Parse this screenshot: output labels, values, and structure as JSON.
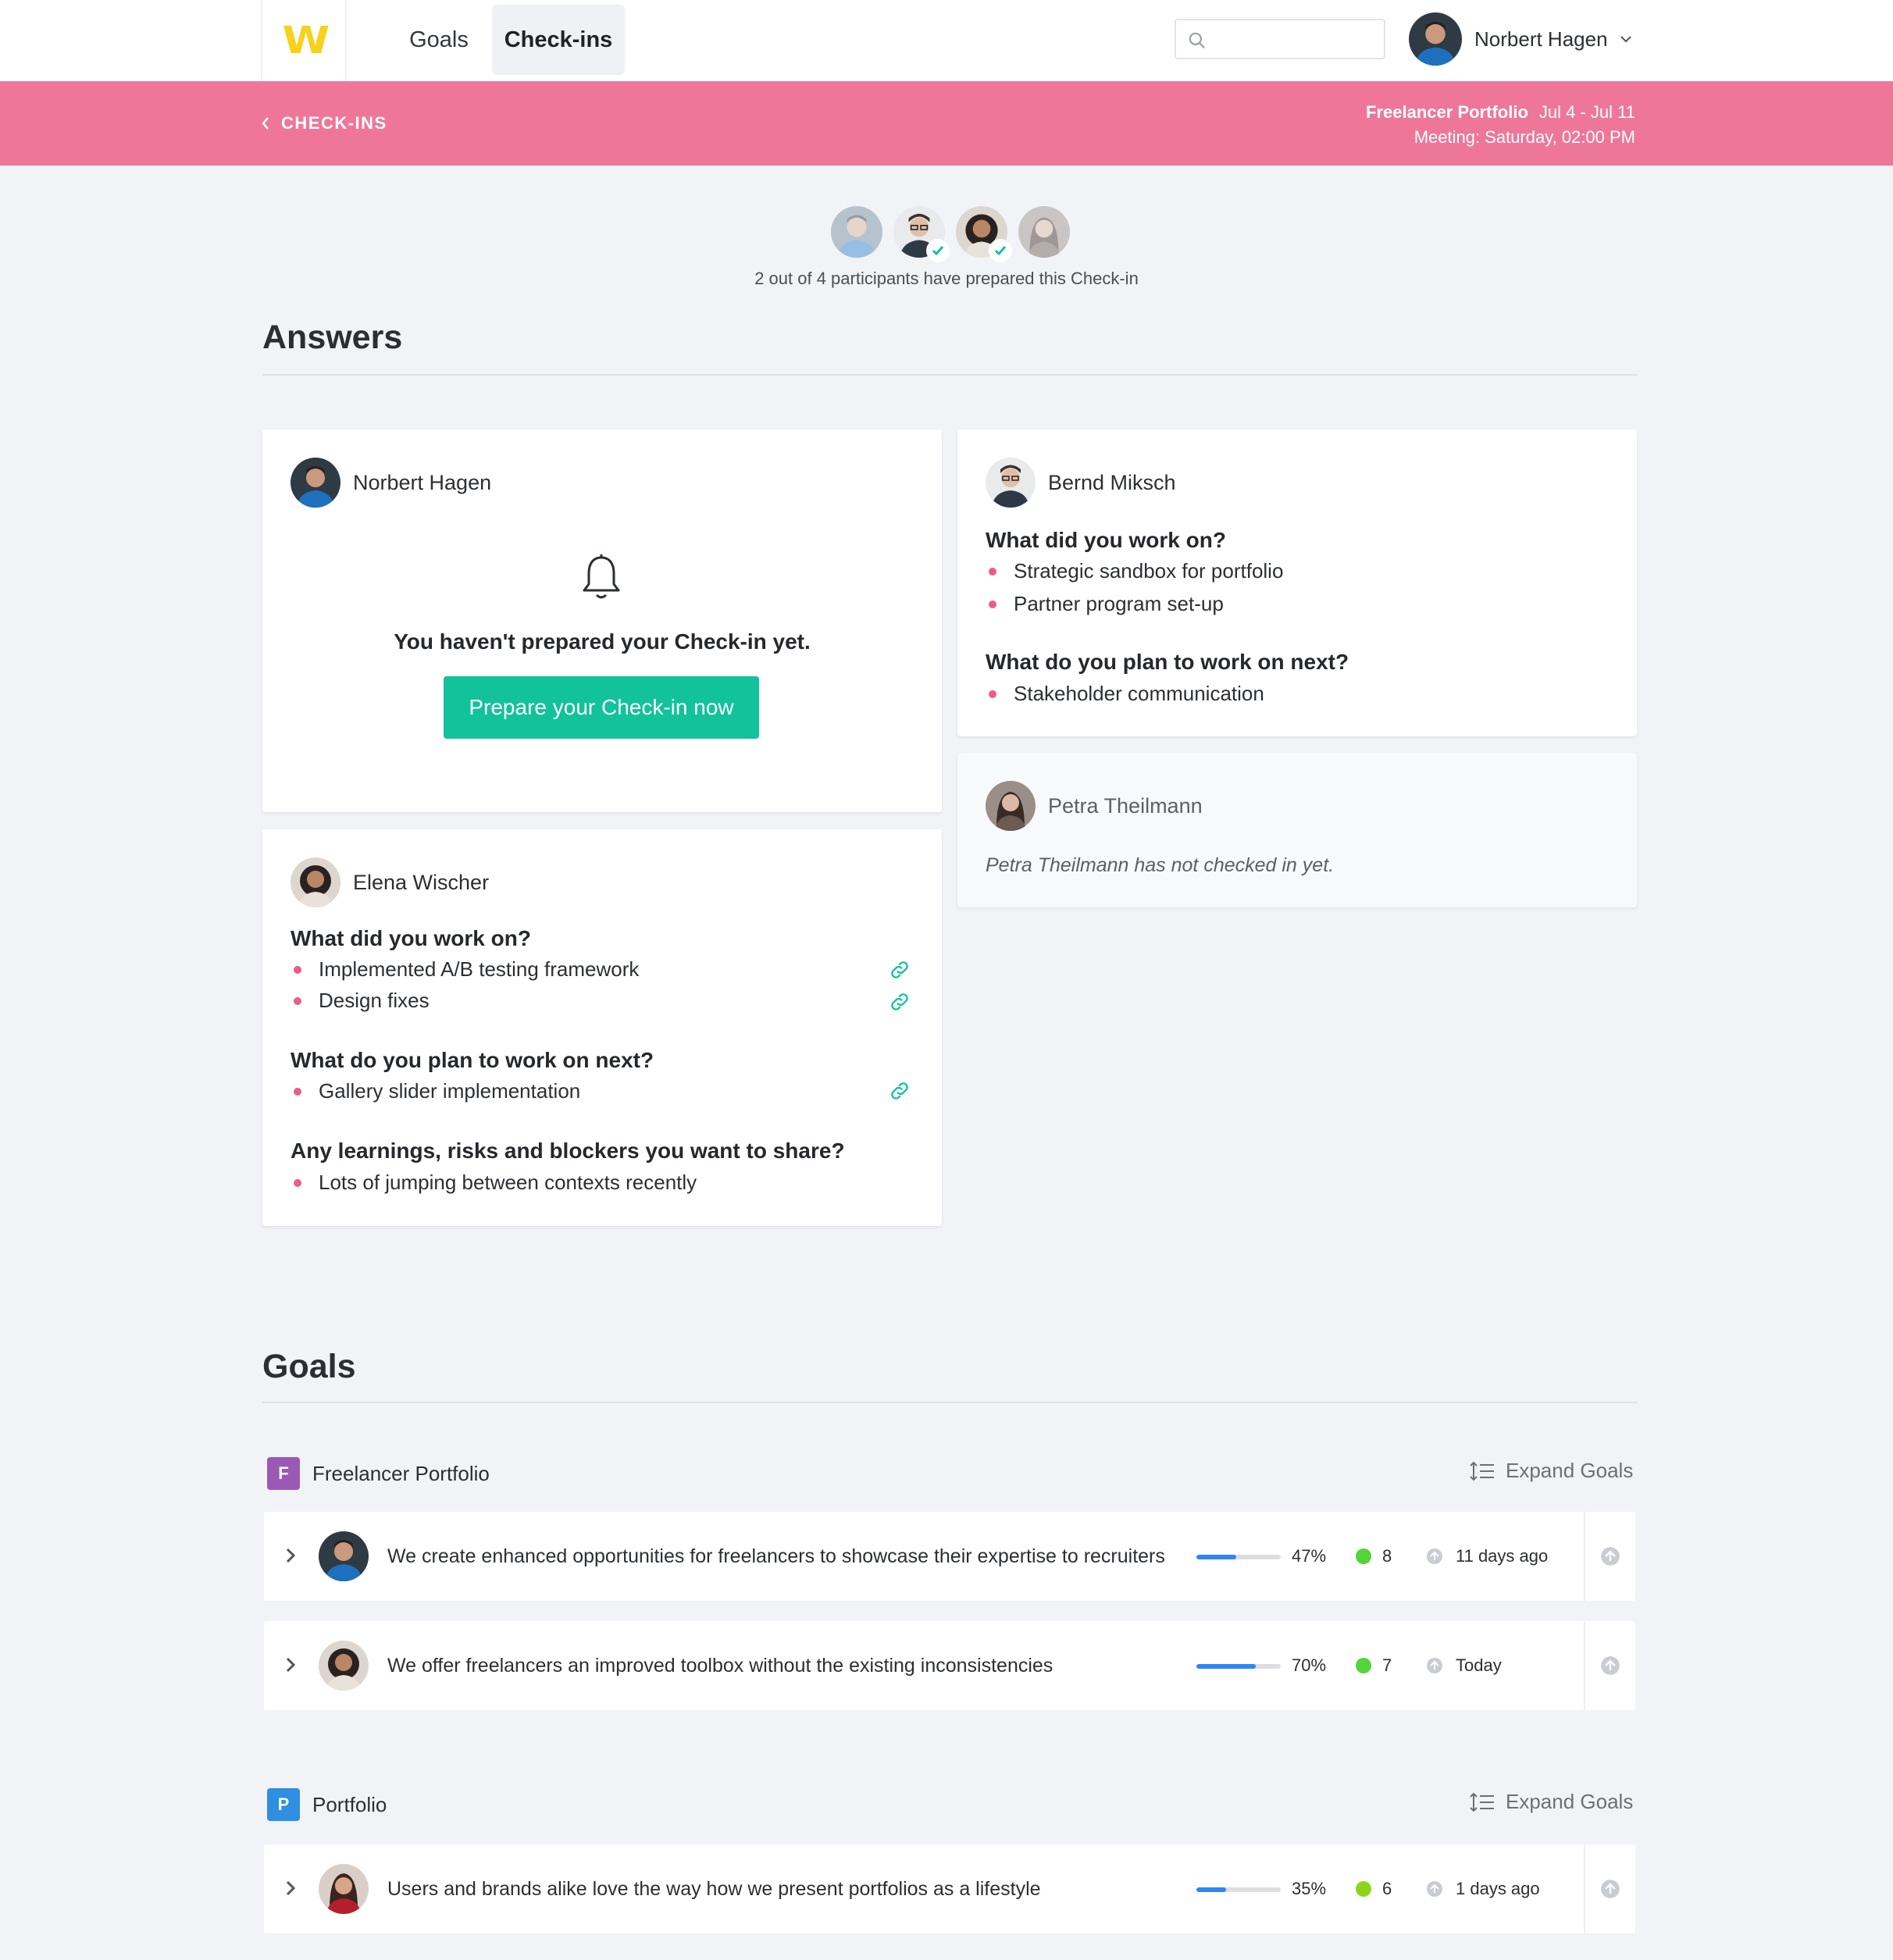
{
  "app": {
    "logo_text": "W",
    "brand_color": "#f7d21b",
    "accent_color": "#ee7799",
    "primary_color": "#12c29b"
  },
  "nav": {
    "tabs": [
      {
        "label": "Goals"
      },
      {
        "label": "Check-ins",
        "active": true
      }
    ]
  },
  "search": {
    "placeholder": "",
    "icon": "search-icon"
  },
  "user": {
    "name": "Norbert Hagen"
  },
  "banner": {
    "back_label": "CHECK-INS",
    "project": "Freelancer Portfolio",
    "date_range": "Jul 4 - Jul 11",
    "meeting": "Meeting: Saturday, 02:00 PM"
  },
  "participants": {
    "people": [
      {
        "name": "Norbert Hagen",
        "prepared": false
      },
      {
        "name": "Bernd Miksch",
        "prepared": true
      },
      {
        "name": "Elena Wischer",
        "prepared": true
      },
      {
        "name": "Petra Theilmann",
        "prepared": false
      }
    ],
    "summary": "2 out of 4 participants have prepared this Check-in"
  },
  "answers": {
    "title": "Answers",
    "norbert": {
      "name": "Norbert Hagen",
      "message": "You haven't prepared your Check-in yet.",
      "button": "Prepare your Check-in now"
    },
    "bernd": {
      "name": "Bernd Miksch",
      "q1": "What did you work on?",
      "q1_items": [
        "Strategic sandbox for portfolio",
        "Partner program set-up"
      ],
      "q2": "What do you plan to work on next?",
      "q2_items": [
        "Stakeholder communication"
      ]
    },
    "petra": {
      "name": "Petra Theilmann",
      "message": "Petra Theilmann has not checked in yet."
    },
    "elena": {
      "name": "Elena Wischer",
      "q1": "What did you work on?",
      "q1_items": [
        "Implemented A/B testing framework",
        "Design fixes"
      ],
      "q2": "What do you plan to work on next?",
      "q2_items": [
        "Gallery slider implementation"
      ],
      "q3": "Any learnings, risks and blockers you want to share?",
      "q3_items": [
        "Lots of jumping between contexts recently"
      ]
    }
  },
  "goals": {
    "title": "Goals",
    "expand_label": "Expand Goals",
    "groups": [
      {
        "badge": "F",
        "badge_color": "#9b59b6",
        "name": "Freelancer Portfolio",
        "items": [
          {
            "text": "We create enhanced opportunities for freelancers to showcase their expertise to recruiters",
            "progress": 47,
            "progress_label": "47%",
            "status_color": "#52d43a",
            "count": "8",
            "updated": "11 days ago"
          },
          {
            "text": "We offer freelancers an improved toolbox without the existing inconsistencies",
            "progress": 70,
            "progress_label": "70%",
            "status_color": "#52d43a",
            "count": "7",
            "updated": "Today"
          }
        ]
      },
      {
        "badge": "P",
        "badge_color": "#2f8fe0",
        "name": "Portfolio",
        "items": [
          {
            "text": "Users and brands alike love the way how we present portfolios as a lifestyle",
            "progress": 35,
            "progress_label": "35%",
            "status_color": "#8ed41c",
            "count": "6",
            "updated": "1 days ago"
          }
        ]
      }
    ]
  }
}
